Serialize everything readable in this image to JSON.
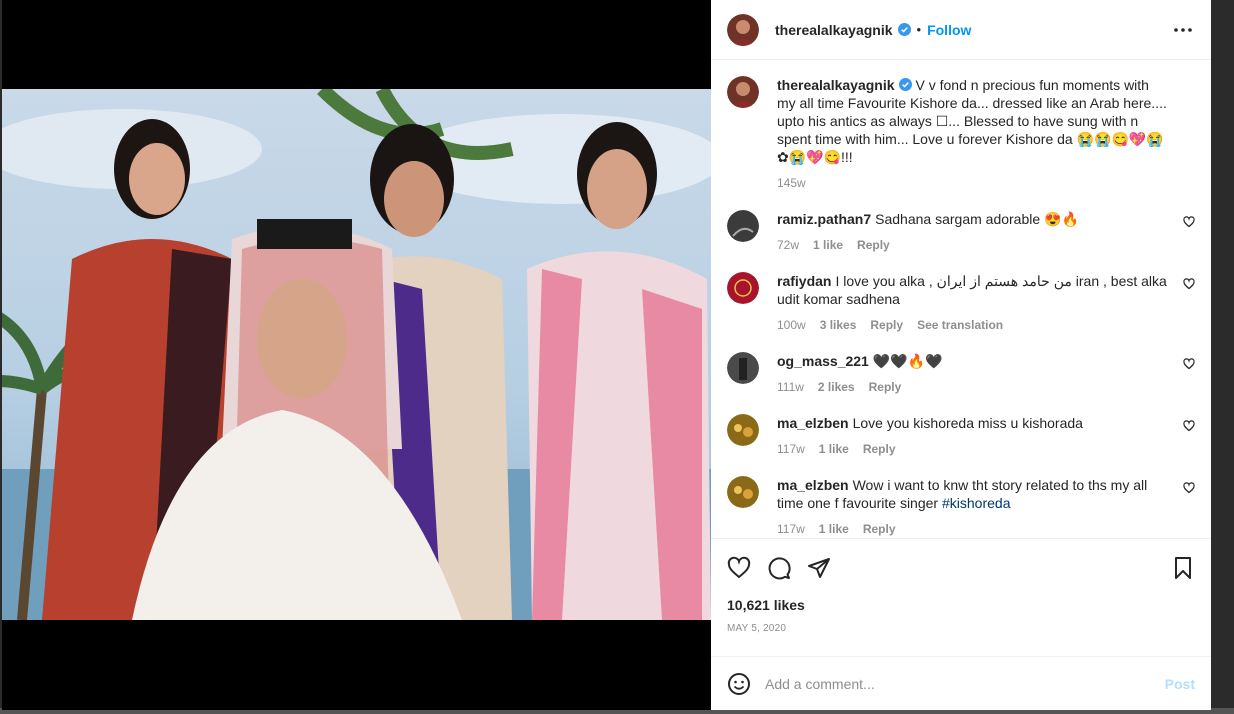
{
  "post": {
    "username": "therealalkayagnik",
    "follow_label": "Follow",
    "dot": "•",
    "caption_text": "V v fond n precious fun moments with my all time Favourite Kishore da... dressed like an Arab here.... upto his antics as always ☐... Blessed to have sung with n spent time with him... Love u forever Kishore da 😭😭😋💖😭✿😭💖😋!!!",
    "caption_time": "145w",
    "likes": "10,621 likes",
    "date": "MAY 5, 2020"
  },
  "comments": [
    {
      "user": "ramiz.pathan7",
      "text": "Sadhana sargam adorable 😍🔥",
      "time": "72w",
      "likes": "1 like",
      "reply": "Reply",
      "avatar_color": "#3b3b3b"
    },
    {
      "user": "rafiydan",
      "text": "I love you alka , من حامد هستم از ایران iran , best alka udit komar sadhena",
      "time": "100w",
      "likes": "3 likes",
      "reply": "Reply",
      "extra": "See translation",
      "avatar_color": "#a8142a"
    },
    {
      "user": "og_mass_221",
      "text": "🖤🖤🔥🖤",
      "time": "111w",
      "likes": "2 likes",
      "reply": "Reply",
      "avatar_color": "#4a4a4a"
    },
    {
      "user": "ma_elzben",
      "text": "Love you kishoreda miss u kishorada",
      "time": "117w",
      "likes": "1 like",
      "reply": "Reply",
      "avatar_color": "#8a6a18"
    },
    {
      "user": "ma_elzben",
      "text": "Wow i want to knw tht story related to ths my all time one f favourite singer",
      "hashtag": "#kishoreda",
      "time": "117w",
      "likes": "1 like",
      "reply": "Reply",
      "avatar_color": "#8a6a18"
    }
  ],
  "composer": {
    "placeholder": "Add a comment...",
    "post_label": "Post"
  },
  "colors": {
    "accent": "#0095f6",
    "post_disabled": "#b2dffc",
    "verified": "#3897f0"
  },
  "icons": [
    "more-icon",
    "verified-icon",
    "heart-icon",
    "comment-icon",
    "share-icon",
    "bookmark-icon",
    "emoji-icon"
  ]
}
